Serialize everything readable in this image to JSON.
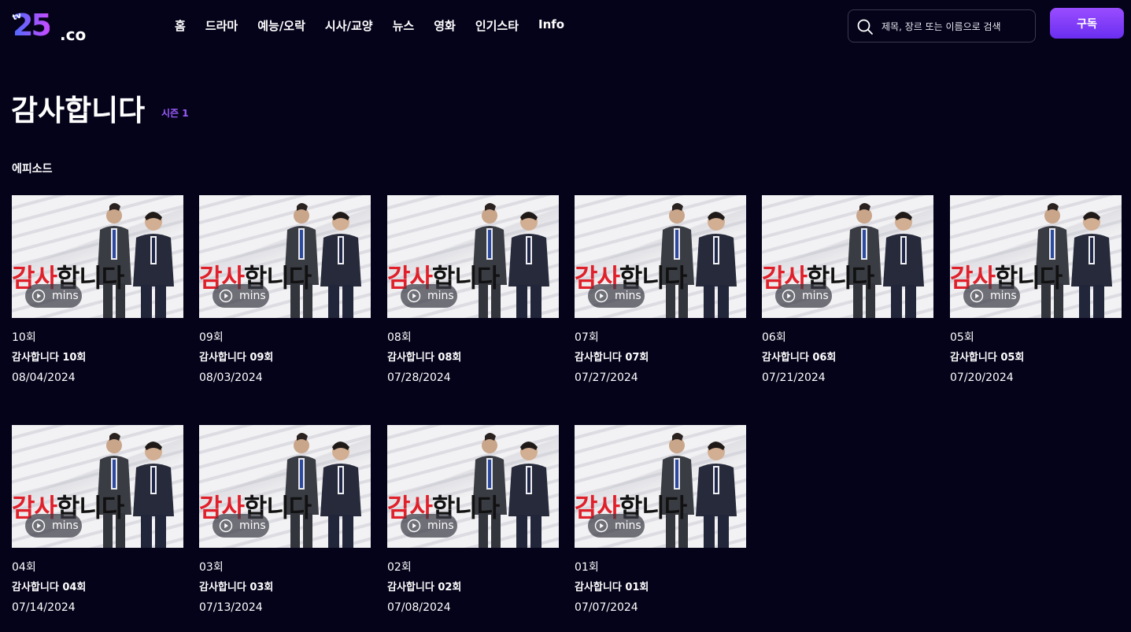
{
  "logo": {
    "tv": "tv",
    "number": "25",
    "suffix": ".co"
  },
  "nav": [
    {
      "label": "홈"
    },
    {
      "label": "드라마"
    },
    {
      "label": "예능/오락"
    },
    {
      "label": "시사/교양"
    },
    {
      "label": "뉴스"
    },
    {
      "label": "영화"
    },
    {
      "label": "인기스타"
    },
    {
      "label": "Info"
    }
  ],
  "search": {
    "placeholder": "제목, 장르 또는 이름으로 검색",
    "icon": "search-icon"
  },
  "subscribe_label": "구독",
  "show": {
    "title": "감사합니다",
    "season": "시즌 1",
    "section": "에피소드"
  },
  "thumbnail_text": {
    "red": "감사",
    "black": "합니다"
  },
  "episodes": [
    {
      "number": "10회",
      "title": "감사합니다 10회",
      "date": "08/04/2024",
      "duration": "mins"
    },
    {
      "number": "09회",
      "title": "감사합니다 09회",
      "date": "08/03/2024",
      "duration": "mins"
    },
    {
      "number": "08회",
      "title": "감사합니다 08회",
      "date": "07/28/2024",
      "duration": "mins"
    },
    {
      "number": "07회",
      "title": "감사합니다 07회",
      "date": "07/27/2024",
      "duration": "mins"
    },
    {
      "number": "06회",
      "title": "감사합니다 06회",
      "date": "07/21/2024",
      "duration": "mins"
    },
    {
      "number": "05회",
      "title": "감사합니다 05회",
      "date": "07/20/2024",
      "duration": "mins"
    },
    {
      "number": "04회",
      "title": "감사합니다 04회",
      "date": "07/14/2024",
      "duration": "mins"
    },
    {
      "number": "03회",
      "title": "감사합니다 03회",
      "date": "07/13/2024",
      "duration": "mins"
    },
    {
      "number": "02회",
      "title": "감사합니다 02회",
      "date": "07/08/2024",
      "duration": "mins"
    },
    {
      "number": "01회",
      "title": "감사합니다 01회",
      "date": "07/07/2024",
      "duration": "mins"
    }
  ],
  "colors": {
    "background": "#05031a",
    "accent": "#9b5cff",
    "button": "#7b3cff"
  }
}
